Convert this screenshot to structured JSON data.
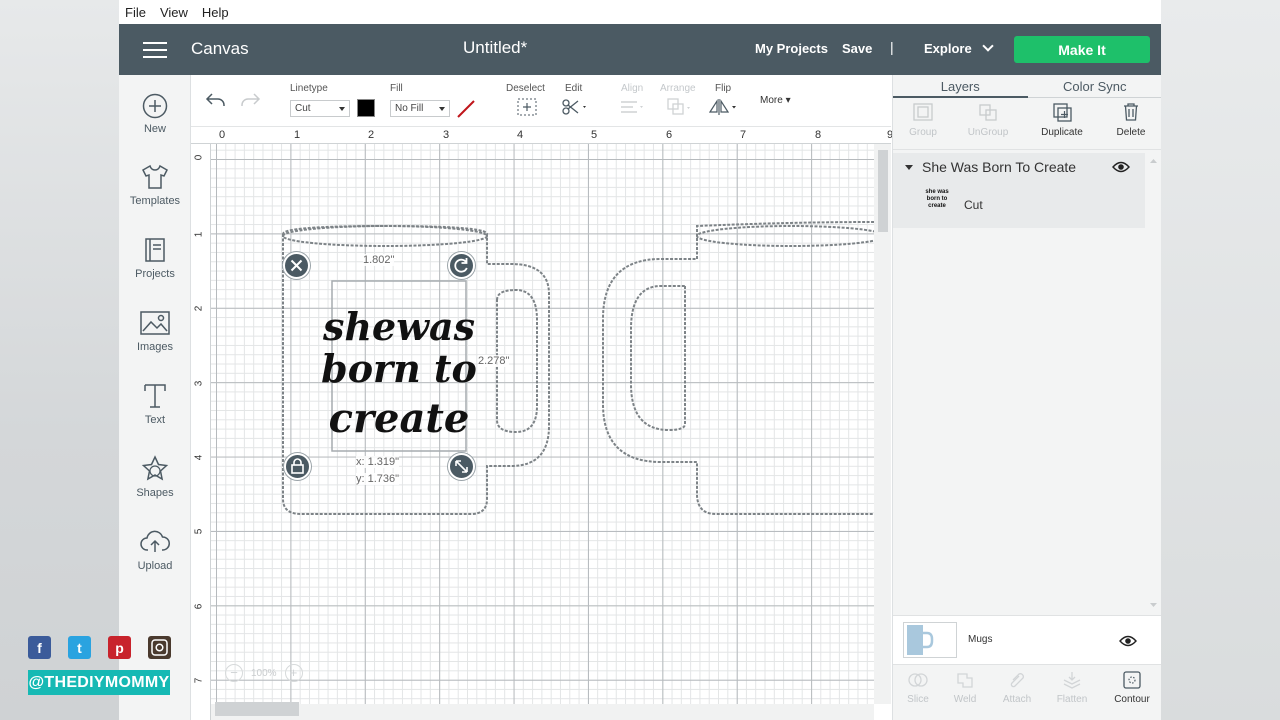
{
  "menu": [
    "File",
    "View",
    "Help"
  ],
  "header": {
    "brand": "Canvas",
    "doc_title": "Untitled*",
    "my_projects": "My Projects",
    "save": "Save",
    "separator": "|",
    "explore": "Explore",
    "make_it": "Make It"
  },
  "rail": {
    "new": "New",
    "templates": "Templates",
    "projects": "Projects",
    "images": "Images",
    "text": "Text",
    "shapes": "Shapes",
    "upload": "Upload"
  },
  "toolbar": {
    "linetype_label": "Linetype",
    "linetype_value": "Cut",
    "fill_label": "Fill",
    "fill_value": "No Fill",
    "deselect": "Deselect",
    "edit": "Edit",
    "align": "Align",
    "arrange": "Arrange",
    "flip": "Flip",
    "more": "More"
  },
  "ruler": {
    "top": [
      "0",
      "1",
      "2",
      "3",
      "4",
      "5",
      "6",
      "7",
      "8",
      "9"
    ],
    "left": [
      "0",
      "1",
      "2",
      "3",
      "4",
      "5",
      "6",
      "7"
    ]
  },
  "selection": {
    "width": "1.802\"",
    "height": "2.278\"",
    "x": "x: 1.319\"",
    "y": "y: 1.736\"",
    "art_lines": [
      "shewas",
      "born to",
      "create"
    ]
  },
  "zoom": {
    "minus": "−",
    "value": "100%",
    "plus": "+"
  },
  "panel": {
    "tabs": [
      "Layers",
      "Color Sync"
    ],
    "actions": {
      "group": "Group",
      "ungroup": "UnGroup",
      "duplicate": "Duplicate",
      "delete": "Delete"
    },
    "layer_group": "She Was Born To Create",
    "layer_item": "Cut",
    "layer_thumb_text": "she was born to create",
    "mugs": "Mugs",
    "bottom": {
      "slice": "Slice",
      "weld": "Weld",
      "attach": "Attach",
      "flatten": "Flatten",
      "contour": "Contour"
    }
  },
  "social": {
    "facebook": "f",
    "twitter": "t",
    "pinterest": "p",
    "handle": "@THEDIYMOMMY"
  },
  "colors": {
    "header": "#4b5a63",
    "make_it": "#1ec06a",
    "handle_tag": "#16b9b4"
  }
}
